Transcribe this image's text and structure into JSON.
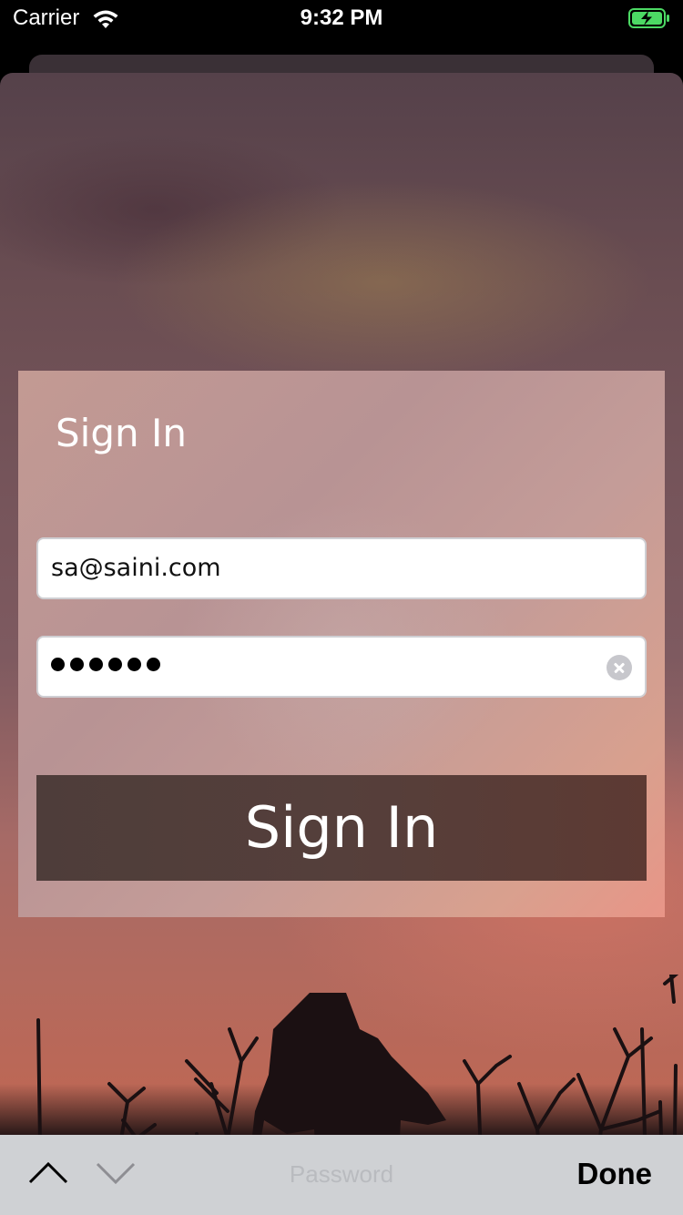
{
  "status_bar": {
    "carrier": "Carrier",
    "time": "9:32 PM",
    "wifi_icon": "wifi-icon",
    "battery_icon": "battery-charging-icon",
    "battery_color": "#4cd964"
  },
  "signin_panel": {
    "title": "Sign In",
    "email_value": "sa@saini.com",
    "password_masked_length": 6,
    "clear_icon": "clear-icon",
    "button_label": "Sign In"
  },
  "keyboard_toolbar": {
    "prev_icon": "chevron-up-icon",
    "next_icon": "chevron-down-icon",
    "current_field": "Password",
    "done_label": "Done"
  }
}
